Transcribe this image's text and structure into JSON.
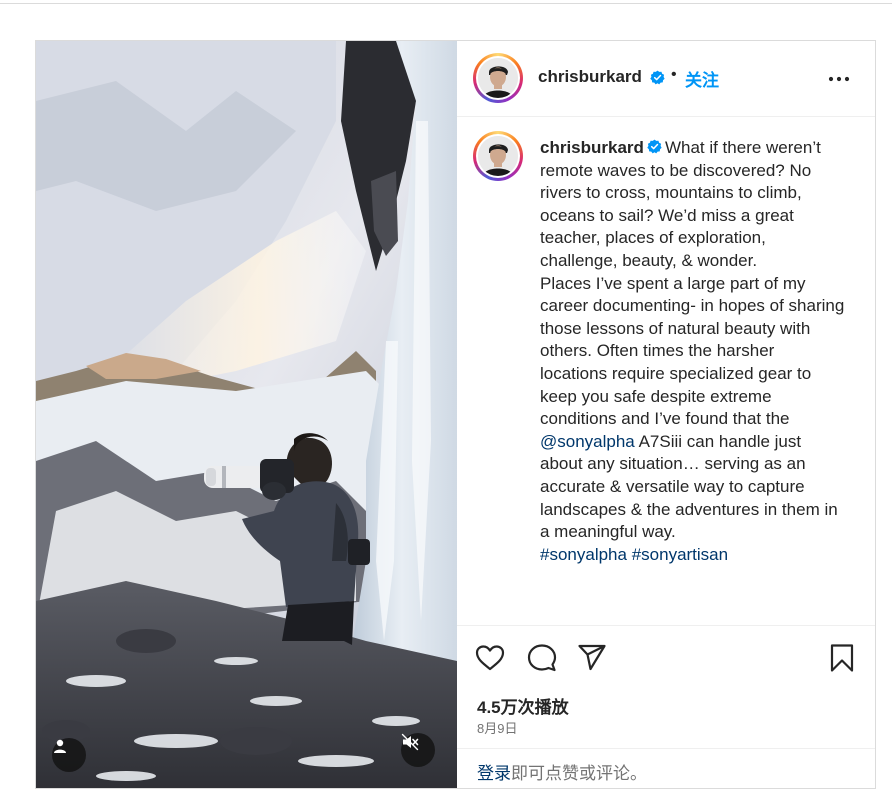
{
  "post": {
    "username": "chrisburkard",
    "follow_label": "关注",
    "dot": "•",
    "caption": {
      "intro": "What if there weren’t remote waves to be discovered? No rivers to cross, mountains to climb, oceans to sail? We’d miss a great teacher, places of exploration, challenge, beauty, & wonder.",
      "body_before_mention": "Places I’ve spent a large part of my career documenting- in hopes of sharing those lessons of natural beauty with others. Often times the harsher locations require specialized gear to keep you safe despite extreme conditions and I’ve found that the",
      "mention": "@sonyalpha",
      "body_after_mention": "A7Siii can handle just about any situation… serving as an accurate & versatile way to capture landscapes & the adventures in them in a meaningful way.",
      "hashtags": [
        "#sonyalpha",
        "#sonyartisan"
      ]
    },
    "views": "4.5万次播放",
    "date": "8月9日",
    "login_link": "登录",
    "login_rest": "即可点赞或评论。"
  },
  "icons": {
    "more": "more-options-icon",
    "verified": "verified-badge-icon",
    "like": "heart-icon",
    "comment": "comment-icon",
    "share": "share-icon",
    "save": "bookmark-icon",
    "user_tag": "user-tag-icon",
    "mute": "muted-speaker-icon"
  },
  "colors": {
    "accent": "#0095f6",
    "link": "#00376b",
    "muted_text": "#737373",
    "divider": "#dbdbdb"
  }
}
